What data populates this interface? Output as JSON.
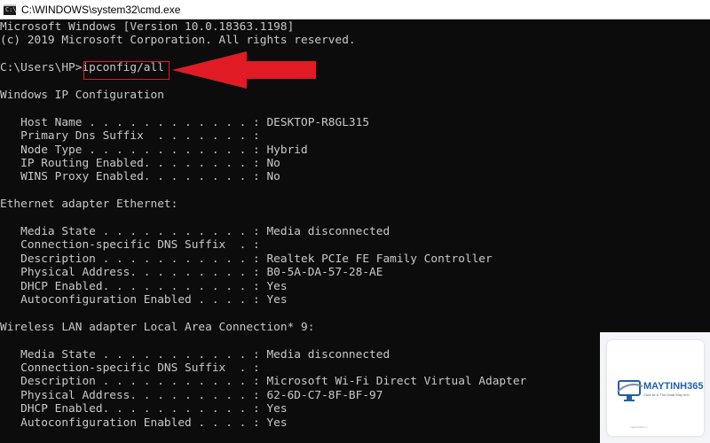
{
  "window": {
    "title": "C:\\WINDOWS\\system32\\cmd.exe",
    "icon_text": "C:\\"
  },
  "console": {
    "lines": [
      "Microsoft Windows [Version 10.0.18363.1198]",
      "(c) 2019 Microsoft Corporation. All rights reserved.",
      "",
      "C:\\Users\\HP>ipconfig/all",
      "",
      "Windows IP Configuration",
      "",
      "   Host Name . . . . . . . . . . . . : DESKTOP-R8GL315",
      "   Primary Dns Suffix  . . . . . . . :",
      "   Node Type . . . . . . . . . . . . : Hybrid",
      "   IP Routing Enabled. . . . . . . . : No",
      "   WINS Proxy Enabled. . . . . . . . : No",
      "",
      "Ethernet adapter Ethernet:",
      "",
      "   Media State . . . . . . . . . . . : Media disconnected",
      "   Connection-specific DNS Suffix  . :",
      "   Description . . . . . . . . . . . : Realtek PCIe FE Family Controller",
      "   Physical Address. . . . . . . . . : B0-5A-DA-57-28-AE",
      "   DHCP Enabled. . . . . . . . . . . : Yes",
      "   Autoconfiguration Enabled . . . . : Yes",
      "",
      "Wireless LAN adapter Local Area Connection* 9:",
      "",
      "   Media State . . . . . . . . . . . : Media disconnected",
      "   Connection-specific DNS Suffix  . :",
      "   Description . . . . . . . . . . . : Microsoft Wi-Fi Direct Virtual Adapter",
      "   Physical Address. . . . . . . . . : 62-6D-C7-8F-BF-97",
      "   DHCP Enabled. . . . . . . . . . . : Yes",
      "   Autoconfiguration Enabled . . . . : Yes"
    ]
  },
  "annotation": {
    "highlight_color": "#e01b24",
    "arrow_icon": "arrow-left-icon"
  },
  "watermark": {
    "brand": "MAYTINH365",
    "tagline": "Chia sẻ & Thủ thuật Máy tính",
    "footer": "maytinh365.vn",
    "brand_color": "#1f5fa8"
  }
}
